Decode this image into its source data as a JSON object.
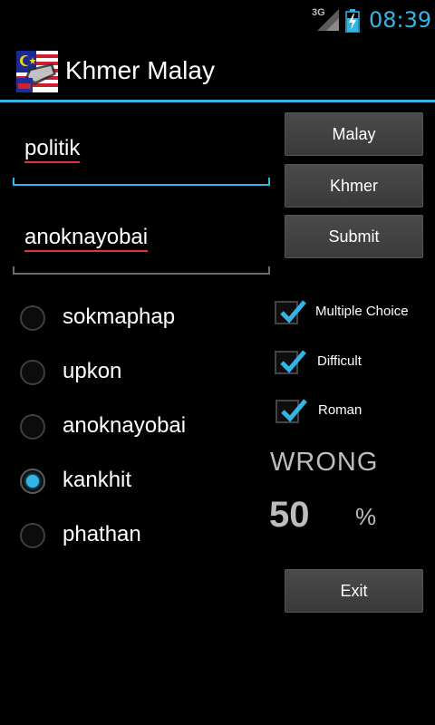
{
  "status_bar": {
    "network": "3G",
    "time": "08:39"
  },
  "action_bar": {
    "title": "Khmer Malay"
  },
  "inputs": {
    "word": "politik",
    "answer": "anoknayobai"
  },
  "buttons": {
    "malay": "Malay",
    "khmer": "Khmer",
    "submit": "Submit",
    "exit": "Exit"
  },
  "choices": [
    {
      "label": "sokmaphap",
      "checked": false
    },
    {
      "label": "upkon",
      "checked": false
    },
    {
      "label": "anoknayobai",
      "checked": false
    },
    {
      "label": "kankhit",
      "checked": true
    },
    {
      "label": "phathan",
      "checked": false
    }
  ],
  "options": {
    "multiple_choice": {
      "label": "Multiple Choice",
      "checked": true
    },
    "difficult": {
      "label": "Difficult",
      "checked": true
    },
    "roman": {
      "label": "Roman",
      "checked": true
    }
  },
  "result": {
    "status": "WRONG",
    "score": "50",
    "unit": "%"
  },
  "colors": {
    "accent": "#33b5e5",
    "background": "#000000",
    "spell_underline": "#e23333"
  }
}
